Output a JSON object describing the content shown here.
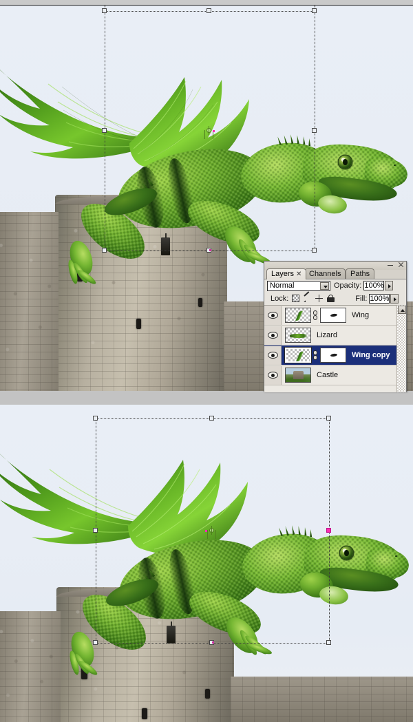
{
  "app": {
    "title": "Adobe Photoshop - Layers panel over image canvas"
  },
  "panel": {
    "tabs": [
      {
        "label": "Layers",
        "closable": true,
        "active": true
      },
      {
        "label": "Channels",
        "closable": false,
        "active": false
      },
      {
        "label": "Paths",
        "closable": false,
        "active": false
      }
    ],
    "window_buttons": {
      "minimize": "minimize-icon",
      "close": "close-icon"
    },
    "menu_icon": "panel-menu-icon",
    "blend_mode": {
      "value": "Normal",
      "dropdown_icon": "chevron-down-icon"
    },
    "opacity": {
      "label": "Opacity:",
      "value": "100%",
      "stepper_icon": "stepper-arrow-icon"
    },
    "lock": {
      "label": "Lock:",
      "icons": [
        "lock-transparent-pixels-icon",
        "lock-image-pixels-icon",
        "lock-position-icon",
        "lock-all-icon"
      ]
    },
    "fill": {
      "label": "Fill:",
      "value": "100%",
      "stepper_icon": "stepper-arrow-icon"
    },
    "scrollbar": {
      "up_arrow_icon": "scroll-up-arrow-icon"
    },
    "layers": [
      {
        "name": "Wing",
        "visible": true,
        "visibility_icon": "eye-icon",
        "thumbnail": "wing-layer-thumbnail",
        "has_link": true,
        "link_icon": "link-chain-icon",
        "has_mask": true,
        "mask_thumbnail": "layer-mask-thumbnail",
        "selected": false
      },
      {
        "name": "Lizard",
        "visible": true,
        "visibility_icon": "eye-icon",
        "thumbnail": "lizard-layer-thumbnail",
        "has_link": false,
        "has_mask": false,
        "selected": false
      },
      {
        "name": "Wing copy",
        "visible": true,
        "visibility_icon": "eye-icon",
        "thumbnail": "wing-copy-layer-thumbnail",
        "has_link": true,
        "link_icon": "link-chain-icon",
        "has_mask": true,
        "mask_thumbnail": "layer-mask-thumbnail",
        "selected": true
      },
      {
        "name": "Castle",
        "visible": true,
        "visibility_icon": "eye-icon",
        "thumbnail": "castle-layer-thumbnail",
        "has_link": false,
        "has_mask": false,
        "selected": false
      }
    ]
  },
  "canvas": {
    "top_pane": {
      "subject": "green dragon-lizard composite perched on stone castle tower",
      "transform_box": {
        "active": true,
        "handles": 8,
        "reference_point": "center"
      }
    },
    "bottom_pane": {
      "subject": "green dragon-lizard composite with both wings, perched on stone castle tower",
      "transform_box": {
        "active": true,
        "handles": 8,
        "reference_point": "center",
        "active_handle": "middle-right"
      }
    }
  },
  "colors": {
    "selection_blue": "#1b2f7a",
    "panel_bg": "#e7e4de",
    "panel_chrome": "#d6d2ca",
    "sky": "#e8edf5",
    "gutter_gray": "#c3c3c3",
    "active_handle": "#ff2fb0",
    "reference_point": "#4f7f1f"
  }
}
